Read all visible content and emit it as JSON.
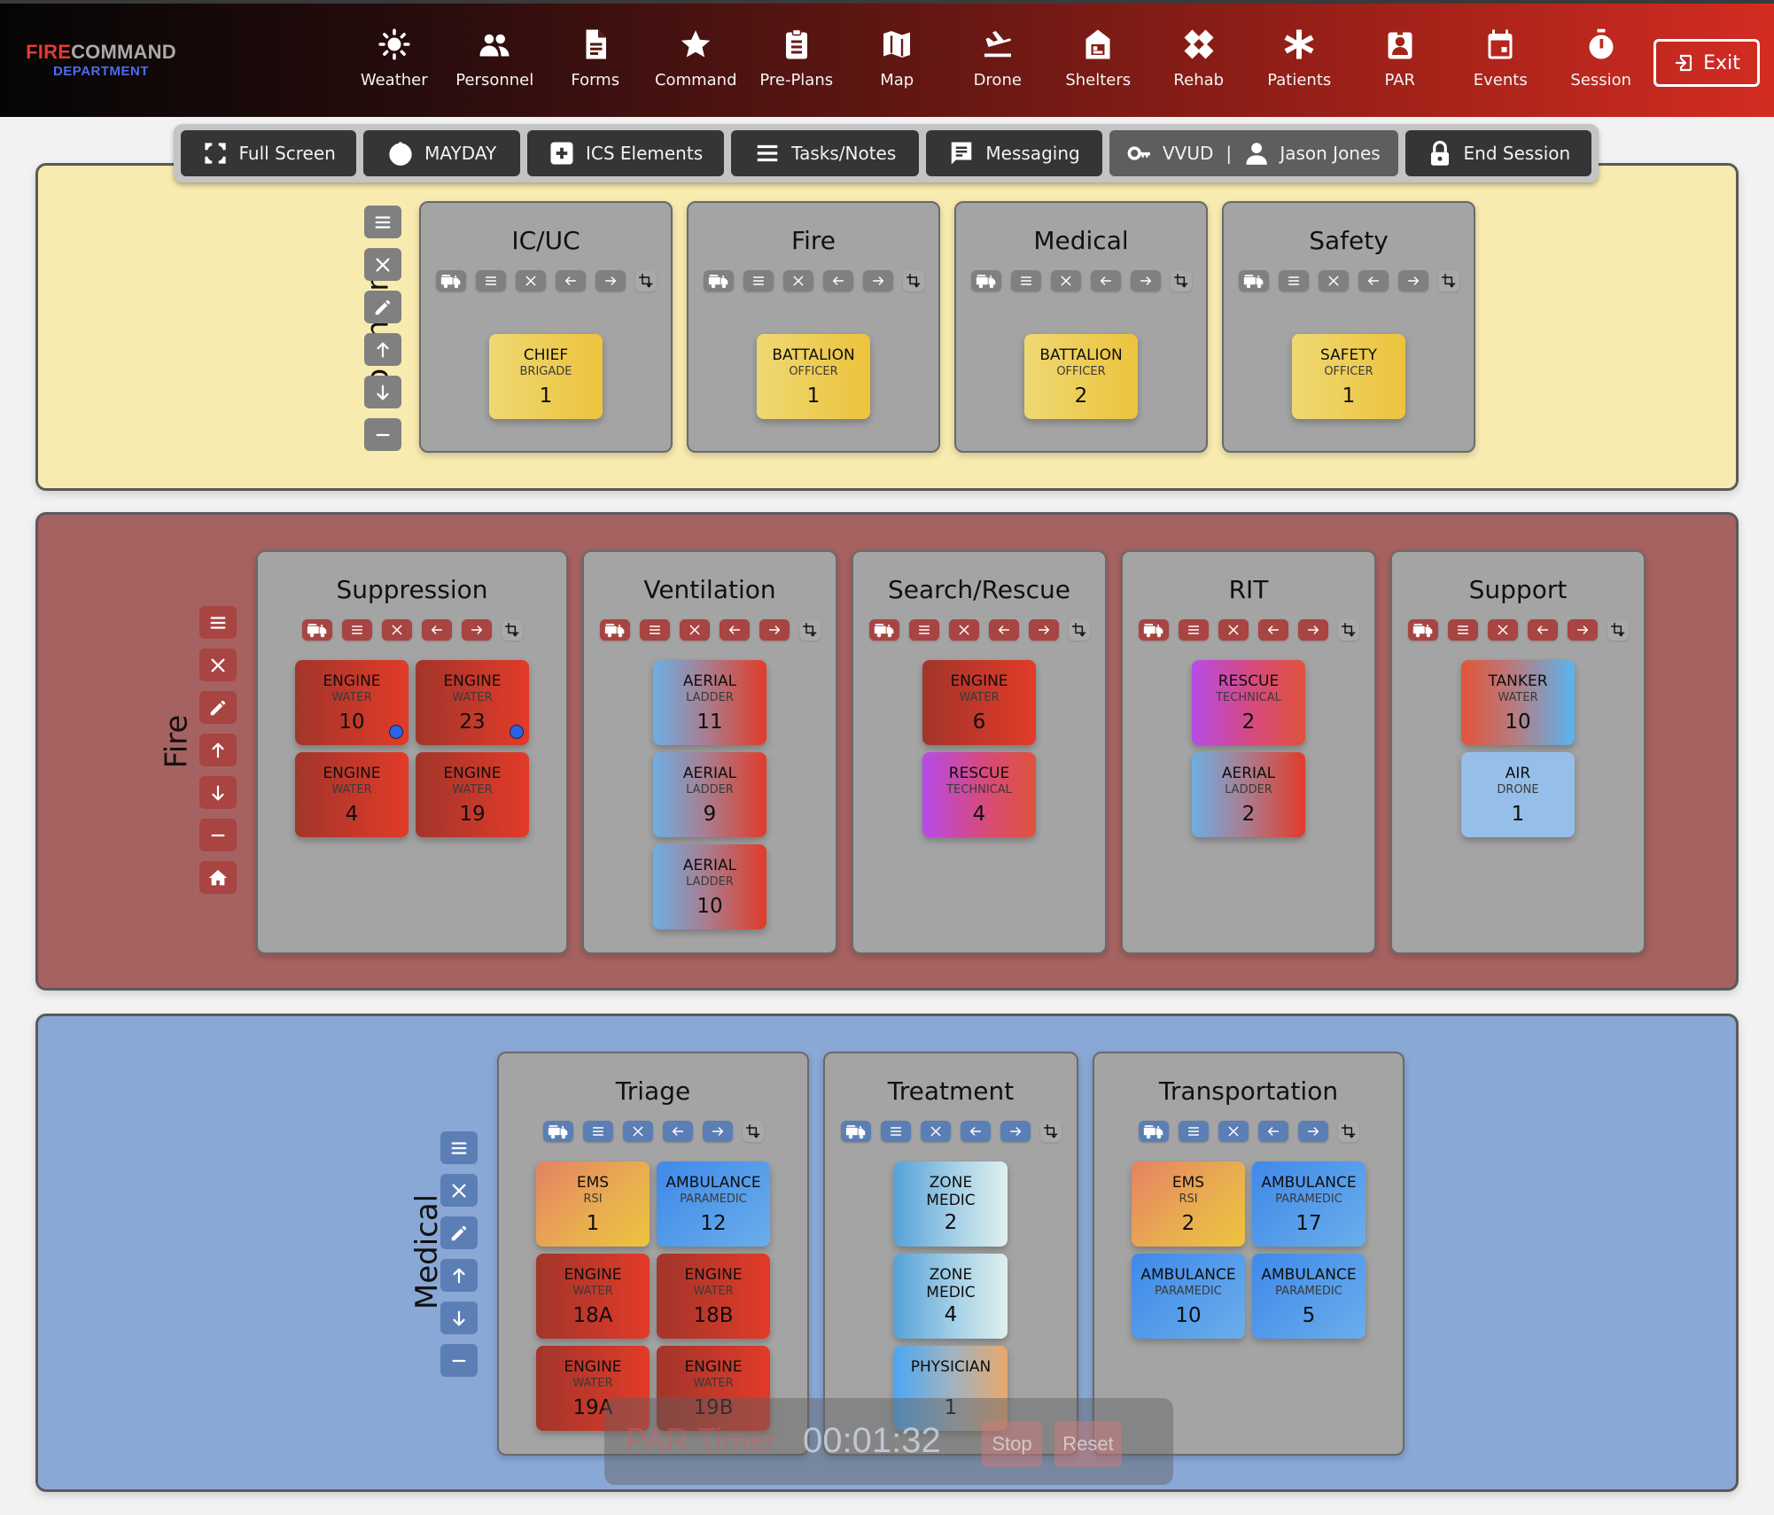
{
  "brand": {
    "fire": "FIRE",
    "command": "COMMAND",
    "department": "DEPARTMENT"
  },
  "nav": [
    {
      "label": "Weather",
      "icon": "sun-icon"
    },
    {
      "label": "Personnel",
      "icon": "users-icon"
    },
    {
      "label": "Forms",
      "icon": "document-icon"
    },
    {
      "label": "Command",
      "icon": "star-icon"
    },
    {
      "label": "Pre-Plans",
      "icon": "clipboard-icon"
    },
    {
      "label": "Map",
      "icon": "map-icon"
    },
    {
      "label": "Drone",
      "icon": "plane-landing-icon"
    },
    {
      "label": "Shelters",
      "icon": "shelter-icon"
    },
    {
      "label": "Rehab",
      "icon": "bandage-icon"
    },
    {
      "label": "Patients",
      "icon": "asterisk-icon"
    },
    {
      "label": "PAR",
      "icon": "badge-icon"
    },
    {
      "label": "Events",
      "icon": "calendar-icon"
    },
    {
      "label": "Session",
      "icon": "stopwatch-icon"
    }
  ],
  "exit_label": "Exit",
  "toolbar": {
    "full_screen": "Full Screen",
    "mayday": "MAYDAY",
    "ics_elements": "ICS Elements",
    "tasks_notes": "Tasks/Notes",
    "messaging": "Messaging",
    "session_code": "VVUD",
    "separator": "|",
    "user_name": "Jason Jones",
    "end_session": "End Session"
  },
  "colors": {
    "command_section": "#f8ebb0",
    "fire_section": "#a66260",
    "medical_section": "#8aa8d6",
    "group_bg": "#a4a4a4",
    "mayday_dot": "#2a62e8"
  },
  "sections": {
    "command": {
      "title": "Command",
      "groups": [
        {
          "title": "IC/UC",
          "units": [
            {
              "type": "CHIEF",
              "sub": "BRIGADE",
              "num": "1",
              "style": "chief"
            }
          ]
        },
        {
          "title": "Fire",
          "units": [
            {
              "type": "BATTALION",
              "sub": "OFFICER",
              "num": "1",
              "style": "chief"
            }
          ]
        },
        {
          "title": "Medical",
          "units": [
            {
              "type": "BATTALION",
              "sub": "OFFICER",
              "num": "2",
              "style": "chief"
            }
          ]
        },
        {
          "title": "Safety",
          "units": [
            {
              "type": "SAFETY",
              "sub": "OFFICER",
              "num": "1",
              "style": "chief"
            }
          ]
        }
      ]
    },
    "fire": {
      "title": "Fire",
      "groups": [
        {
          "title": "Suppression",
          "units": [
            {
              "type": "ENGINE",
              "sub": "WATER",
              "num": "10",
              "style": "engine",
              "dot": true
            },
            {
              "type": "ENGINE",
              "sub": "WATER",
              "num": "23",
              "style": "engine",
              "dot": true
            },
            {
              "type": "ENGINE",
              "sub": "WATER",
              "num": "4",
              "style": "engine"
            },
            {
              "type": "ENGINE",
              "sub": "WATER",
              "num": "19",
              "style": "engine"
            }
          ]
        },
        {
          "title": "Ventilation",
          "units": [
            {
              "type": "AERIAL",
              "sub": "LADDER",
              "num": "11",
              "style": "aerial"
            },
            {
              "type": "AERIAL",
              "sub": "LADDER",
              "num": "9",
              "style": "aerial"
            },
            {
              "type": "AERIAL",
              "sub": "LADDER",
              "num": "10",
              "style": "aerial"
            }
          ]
        },
        {
          "title": "Search/Rescue",
          "units": [
            {
              "type": "ENGINE",
              "sub": "WATER",
              "num": "6",
              "style": "engine"
            },
            {
              "type": "RESCUE",
              "sub": "TECHNICAL",
              "num": "4",
              "style": "rescue"
            }
          ]
        },
        {
          "title": "RIT",
          "units": [
            {
              "type": "RESCUE",
              "sub": "TECHNICAL",
              "num": "2",
              "style": "rescue"
            },
            {
              "type": "AERIAL",
              "sub": "LADDER",
              "num": "2",
              "style": "aerial"
            }
          ]
        },
        {
          "title": "Support",
          "units": [
            {
              "type": "TANKER",
              "sub": "WATER",
              "num": "10",
              "style": "tanker"
            },
            {
              "type": "AIR",
              "sub": "DRONE",
              "num": "1",
              "style": "air"
            }
          ]
        }
      ]
    },
    "medical": {
      "title": "Medical",
      "groups": [
        {
          "title": "Triage",
          "units": [
            {
              "type": "EMS",
              "sub": "RSI",
              "num": "1",
              "style": "ems"
            },
            {
              "type": "AMBULANCE",
              "sub": "PARAMEDIC",
              "num": "12",
              "style": "amb"
            },
            {
              "type": "ENGINE",
              "sub": "WATER",
              "num": "18A",
              "style": "engine"
            },
            {
              "type": "ENGINE",
              "sub": "WATER",
              "num": "18B",
              "style": "engine"
            },
            {
              "type": "ENGINE",
              "sub": "WATER",
              "num": "19A",
              "style": "engine"
            },
            {
              "type": "ENGINE",
              "sub": "WATER",
              "num": "19B",
              "style": "engine"
            }
          ]
        },
        {
          "title": "Treatment",
          "units": [
            {
              "type": "ZONE",
              "sub2": "MEDIC",
              "num": "2",
              "style": "zone"
            },
            {
              "type": "ZONE",
              "sub2": "MEDIC",
              "num": "4",
              "style": "zone"
            },
            {
              "type": "PHYSICIAN",
              "sub": "",
              "num": "1",
              "style": "phys"
            }
          ]
        },
        {
          "title": "Transportation",
          "units": [
            {
              "type": "EMS",
              "sub": "RSI",
              "num": "2",
              "style": "ems"
            },
            {
              "type": "AMBULANCE",
              "sub": "PARAMEDIC",
              "num": "17",
              "style": "amb"
            },
            {
              "type": "AMBULANCE",
              "sub": "PARAMEDIC",
              "num": "10",
              "style": "amb"
            },
            {
              "type": "AMBULANCE",
              "sub": "PARAMEDIC",
              "num": "5",
              "style": "amb"
            }
          ]
        }
      ]
    }
  },
  "par_timer": {
    "label": "PAR Timer",
    "time": "00:01:32",
    "stop": "Stop",
    "reset": "Reset"
  }
}
